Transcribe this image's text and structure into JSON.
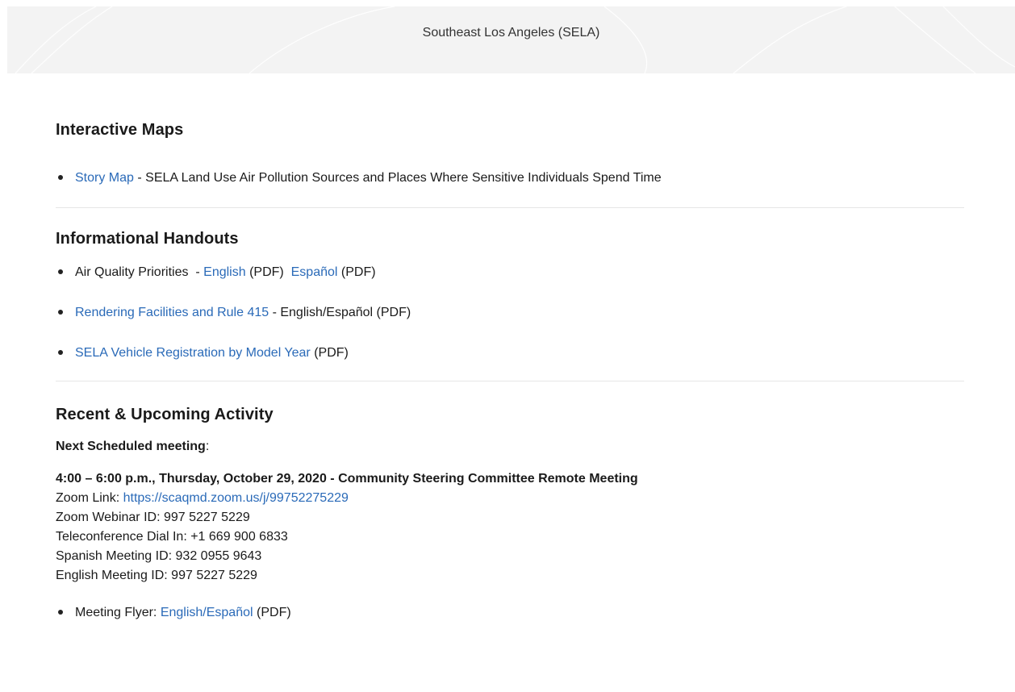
{
  "banner": {
    "title": "Southeast Los Angeles (SELA)"
  },
  "interactive_maps": {
    "heading": "Interactive Maps",
    "items": [
      {
        "link_text": "Story Map",
        "text": " - SELA Land Use Air Pollution Sources and Places Where Sensitive Individuals Spend Time"
      }
    ]
  },
  "handouts": {
    "heading": "Informational Handouts",
    "item1": {
      "prefix": "Air Quality Priorities  - ",
      "link1": "English",
      "mid": " (PDF)  ",
      "link2": "Español",
      "suffix": " (PDF)"
    },
    "item2": {
      "link": "Rendering Facilities and Rule 415",
      "suffix": " - English/Español (PDF)"
    },
    "item3": {
      "link": "SELA Vehicle Registration by Model Year",
      "suffix": " (PDF)"
    }
  },
  "activity": {
    "heading": "Recent & Upcoming Activity",
    "next_label": "Next Scheduled meeting",
    "next_colon": ":",
    "meeting_title": "4:00 – 6:00 p.m., Thursday, October 29, 2020 - Community Steering Committee Remote Meeting",
    "zoom_label": "Zoom Link: ",
    "zoom_url": "https://scaqmd.zoom.us/j/99752275229",
    "webinar": "Zoom Webinar ID: 997 5227 5229",
    "dial_in": "Teleconference Dial In: +1 669 900 6833",
    "spanish_id": "Spanish Meeting ID: 932 0955 9643",
    "english_id": "English Meeting ID: 997 5227 5229",
    "flyer_prefix": "Meeting Flyer: ",
    "flyer_link": "English/Español",
    "flyer_suffix": " (PDF)"
  },
  "colors": {
    "link": "#2a6ab8",
    "banner_bg": "#f3f3f3",
    "divider": "#e6e6e6"
  }
}
